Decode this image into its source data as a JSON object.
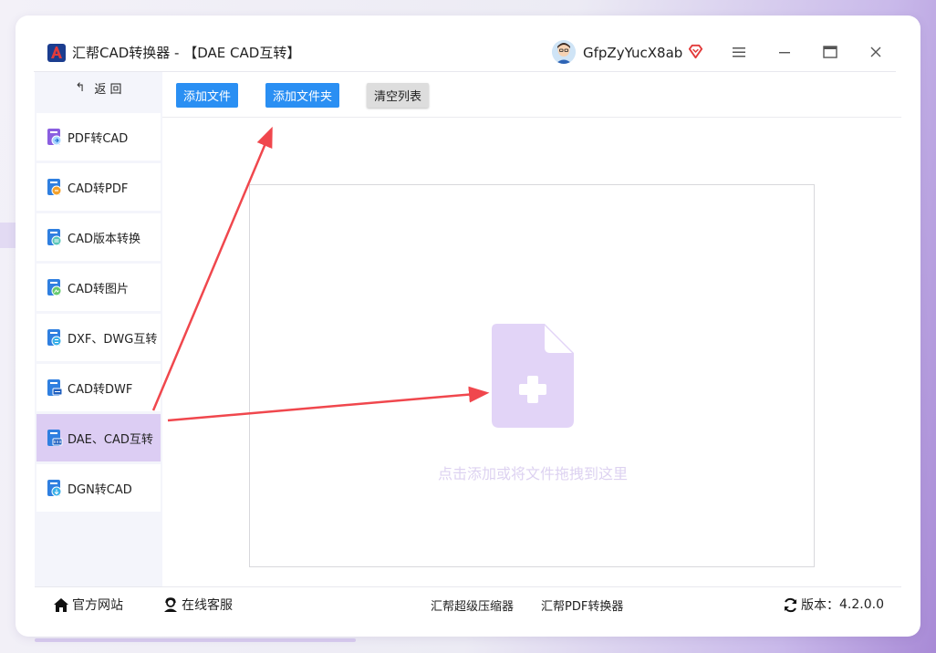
{
  "window": {
    "title": "汇帮CAD转换器 - 【DAE CAD互转】",
    "user": "GfpZyYucX8ab"
  },
  "sidebar": {
    "back_label": "返 回",
    "items": [
      {
        "label": "PDF转CAD",
        "icon": "pdf-to-cad-icon"
      },
      {
        "label": "CAD转PDF",
        "icon": "cad-to-pdf-icon"
      },
      {
        "label": "CAD版本转换",
        "icon": "cad-version-icon"
      },
      {
        "label": "CAD转图片",
        "icon": "cad-to-image-icon"
      },
      {
        "label": "DXF、DWG互转",
        "icon": "dxf-dwg-icon"
      },
      {
        "label": "CAD转DWF",
        "icon": "cad-to-dwf-icon"
      },
      {
        "label": "DAE、CAD互转",
        "icon": "dae-cad-icon",
        "active": true
      },
      {
        "label": "DGN转CAD",
        "icon": "dgn-to-cad-icon"
      }
    ]
  },
  "toolbar": {
    "add_file": "添加文件",
    "add_folder": "添加文件夹",
    "clear_list": "清空列表"
  },
  "dropzone": {
    "hint": "点击添加或将文件拖拽到这里"
  },
  "footer": {
    "website": "官方网站",
    "support": "在线客服",
    "compressor": "汇帮超级压缩器",
    "pdf_converter": "汇帮PDF转换器",
    "version_label": "版本：",
    "version": "4.2.0.0"
  },
  "colors": {
    "accent_purple": "#dccdf3",
    "button_blue": "#2a8ff3",
    "file_icon": "#e2d4f7",
    "arrow_red": "#f0474d"
  }
}
